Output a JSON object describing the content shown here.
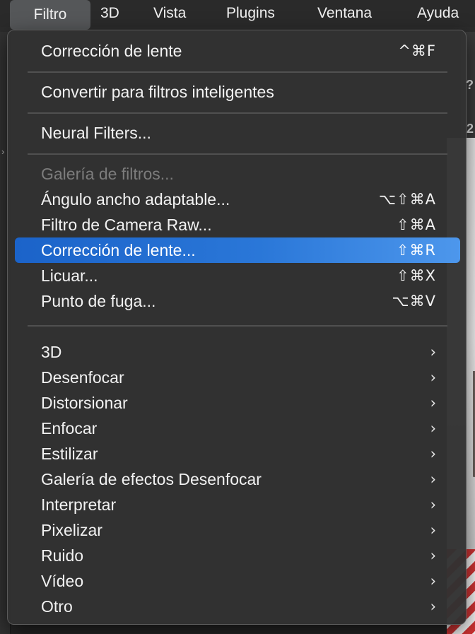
{
  "menubar": {
    "items": [
      "Filtro",
      "3D",
      "Vista",
      "Plugins",
      "Ventana",
      "Ayuda"
    ],
    "active": "Filtro"
  },
  "menu": {
    "group1": [
      {
        "label": "Corrección de lente",
        "shortcut": "^⌘F"
      }
    ],
    "group2": [
      {
        "label": "Convertir para filtros inteligentes"
      }
    ],
    "group3": [
      {
        "label": "Neural Filters..."
      }
    ],
    "group4": [
      {
        "label": "Galería de filtros...",
        "disabled": true
      },
      {
        "label": "Ángulo ancho adaptable...",
        "shortcut": "⌥⇧⌘A"
      },
      {
        "label": "Filtro de Camera Raw...",
        "shortcut": "⇧⌘A"
      },
      {
        "label": "Corrección de lente...",
        "shortcut": "⇧⌘R",
        "highlighted": true
      },
      {
        "label": "Licuar...",
        "shortcut": "⇧⌘X"
      },
      {
        "label": "Punto de fuga...",
        "shortcut": "⌥⌘V"
      }
    ],
    "submenus": [
      {
        "label": "3D",
        "chevron": "›"
      },
      {
        "label": "Desenfocar",
        "chevron": "›"
      },
      {
        "label": "Distorsionar",
        "chevron": "›"
      },
      {
        "label": "Enfocar",
        "chevron": "›"
      },
      {
        "label": "Estilizar",
        "chevron": "›"
      },
      {
        "label": "Galería de efectos Desenfocar",
        "chevron": "›"
      },
      {
        "label": "Interpretar",
        "chevron": "›"
      },
      {
        "label": "Pixelizar",
        "chevron": "›"
      },
      {
        "label": "Ruido",
        "chevron": "›"
      },
      {
        "label": "Vídeo",
        "chevron": "›"
      },
      {
        "label": "Otro",
        "chevron": "›"
      }
    ]
  },
  "background": {
    "side_glyph": "›",
    "right_glyph_1": "?",
    "right_glyph_2": "2"
  },
  "colors": {
    "highlight": "#2a77d8",
    "menu_bg": "#323232",
    "text": "#f2f2f2",
    "disabled_text": "#7c7c7c"
  }
}
